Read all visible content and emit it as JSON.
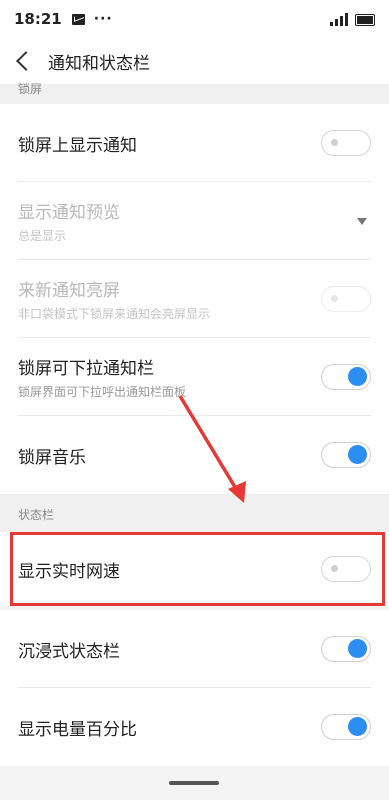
{
  "status_bar": {
    "time": "18:21",
    "icons": [
      "mail-icon",
      "more-dots-icon",
      "signal-icon",
      "battery-icon"
    ],
    "more": "···"
  },
  "nav": {
    "back_icon": "chevron-left-icon",
    "title": "通知和状态栏"
  },
  "sections": {
    "lock_screen": {
      "header": "锁屏"
    },
    "status_bar": {
      "header": "状态栏"
    }
  },
  "rows": {
    "show_notifications_lock": {
      "title": "锁屏上显示通知",
      "toggle": false
    },
    "notification_preview": {
      "title": "显示通知预览",
      "subtitle": "总是显示",
      "enabled": false
    },
    "wake_on_notification": {
      "title": "来新通知亮屏",
      "subtitle": "非口袋模式下锁屏来通知会亮屏显示",
      "enabled": false,
      "toggle": false
    },
    "pull_down_lock": {
      "title": "锁屏可下拉通知栏",
      "subtitle": "锁屏界面可下拉呼出通知栏面板",
      "toggle": true
    },
    "lock_music": {
      "title": "锁屏音乐",
      "toggle": true
    },
    "realtime_speed": {
      "title": "显示实时网速",
      "toggle": false
    },
    "immersive_status": {
      "title": "沉浸式状态栏",
      "toggle": true
    },
    "battery_percent": {
      "title": "显示电量百分比",
      "toggle": true
    }
  },
  "colors": {
    "accent": "#2b8ef0",
    "annotation": "#e53935"
  }
}
